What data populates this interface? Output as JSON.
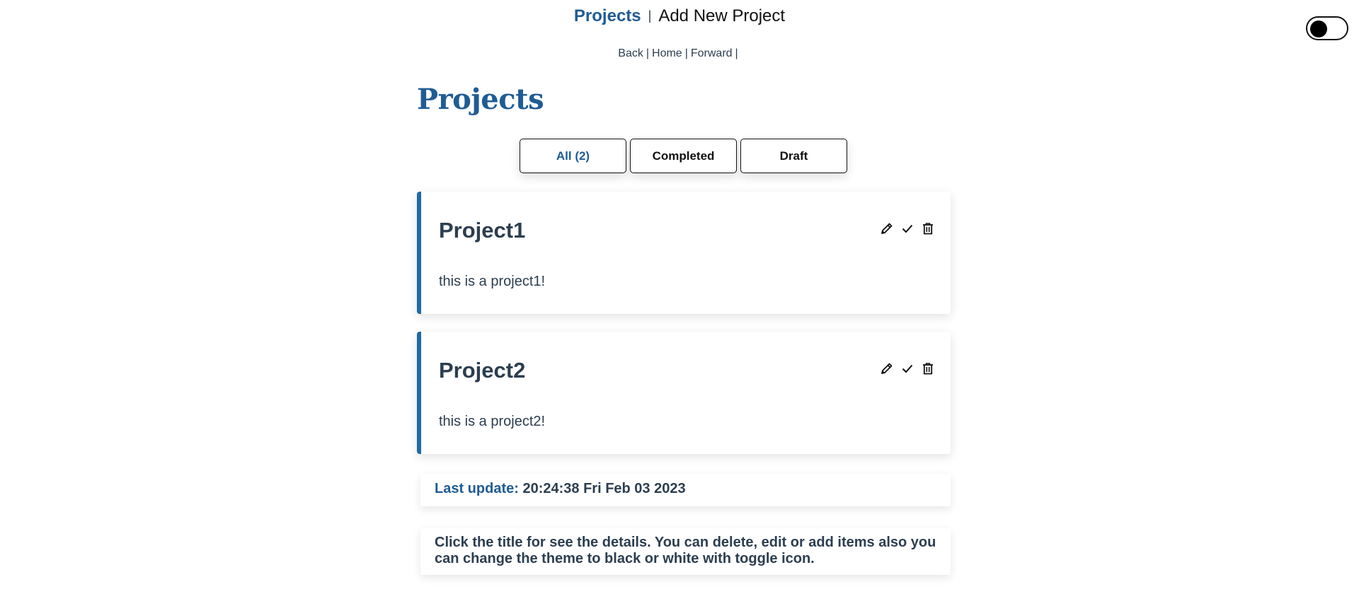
{
  "topnav": {
    "projects": "Projects",
    "separator": "|",
    "add_new": "Add New Project"
  },
  "history": {
    "back": "Back",
    "home": "Home",
    "forward": "Forward",
    "sep": "|"
  },
  "page": {
    "title": "Projects"
  },
  "filters": [
    {
      "label": "All (2)",
      "active": true
    },
    {
      "label": "Completed",
      "active": false
    },
    {
      "label": "Draft",
      "active": false
    }
  ],
  "projects": [
    {
      "title": "Project1",
      "description": "this is a project1!"
    },
    {
      "title": "Project2",
      "description": "this is a project2!"
    }
  ],
  "last_update": {
    "label": "Last update:",
    "value": "20:24:38 Fri Feb 03 2023"
  },
  "help_text": "Click the title for see the details. You can delete, edit or add items also you can change the theme to black or white with toggle icon.",
  "icons": {
    "edit": "pencil-icon",
    "complete": "check-icon",
    "delete": "trash-icon"
  },
  "colors": {
    "accent": "#1f5c94",
    "card_border": "#1f6aa5",
    "text": "#2c3e50"
  }
}
